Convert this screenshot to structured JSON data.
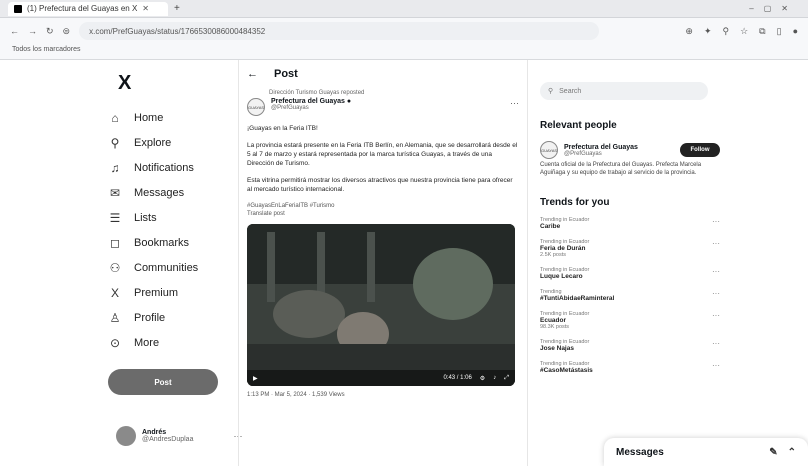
{
  "browser": {
    "tab_title": "(1) Prefectura del Guayas en X",
    "url": "x.com/PrefGuayas/status/1766530086000484352",
    "bookmark": "Todos los marcadores"
  },
  "nav": {
    "logo": "X",
    "items": [
      {
        "icon": "home-icon",
        "glyph": "⌂",
        "label": "Home"
      },
      {
        "icon": "search-icon",
        "glyph": "⚲",
        "label": "Explore"
      },
      {
        "icon": "bell-icon",
        "glyph": "♫",
        "label": "Notifications"
      },
      {
        "icon": "mail-icon",
        "glyph": "✉",
        "label": "Messages"
      },
      {
        "icon": "list-icon",
        "glyph": "☰",
        "label": "Lists"
      },
      {
        "icon": "bookmark-icon",
        "glyph": "◻",
        "label": "Bookmarks"
      },
      {
        "icon": "people-icon",
        "glyph": "⚇",
        "label": "Communities"
      },
      {
        "icon": "x-icon",
        "glyph": "X",
        "label": "Premium"
      },
      {
        "icon": "profile-icon",
        "glyph": "♙",
        "label": "Profile"
      },
      {
        "icon": "more-icon",
        "glyph": "⊙",
        "label": "More"
      }
    ],
    "post_button": "Post"
  },
  "account": {
    "name": "Andrés",
    "handle": "@AndresDuplaa"
  },
  "post": {
    "header": "Post",
    "reposted_by": "Dirección Turismo Guayas reposted",
    "author_name": "Prefectura del Guayas",
    "author_handle": "@PrefGuayas",
    "avatar_text": "GUAYAS",
    "paragraphs": [
      "¡Guayas en la Feria ITB!",
      "La provincia estará presente en la Feria ITB Berlín, en Alemania, que se desarrollará desde el 5 al 7 de marzo y estará representada por la marca turística Guayas, a través de una Dirección de Turismo.",
      "Esta vitrina permitirá mostrar los diversos atractivos que nuestra provincia tiene para ofrecer al mercado turístico internacional."
    ],
    "hashtags": "#GuayasEnLaFeriaITB #Turismo",
    "subtext": "Translate post",
    "video_time": "0:43 / 1:06",
    "meta": "1:13 PM · Mar 5, 2024 · 1,539 Views"
  },
  "sidebar": {
    "search_placeholder": "Search",
    "relevant_title": "Relevant people",
    "person_name": "Prefectura del Guayas",
    "person_handle": "@PrefGuayas",
    "follow_label": "Follow",
    "person_bio": "Cuenta oficial de la Prefectura del Guayas. Prefecta Marcela Aguiñaga y su equipo de trabajo al servicio de la provincia.",
    "trends_title": "Trends for you",
    "trends": [
      {
        "meta": "Trending in Ecuador",
        "name": "Caribe",
        "count": ""
      },
      {
        "meta": "Trending in Ecuador",
        "name": "Feria de Durán",
        "count": "2.5K posts"
      },
      {
        "meta": "Trending in Ecuador",
        "name": "Luque Lecaro",
        "count": ""
      },
      {
        "meta": "Trending",
        "name": "#TuntiAbidaeRaminteral",
        "count": ""
      },
      {
        "meta": "Trending in Ecuador",
        "name": "Ecuador",
        "count": "98.3K posts"
      },
      {
        "meta": "Trending in Ecuador",
        "name": "Jose Najas",
        "count": ""
      },
      {
        "meta": "Trending in Ecuador",
        "name": "#CasoMetástasis",
        "count": ""
      }
    ]
  },
  "messages": {
    "label": "Messages"
  }
}
